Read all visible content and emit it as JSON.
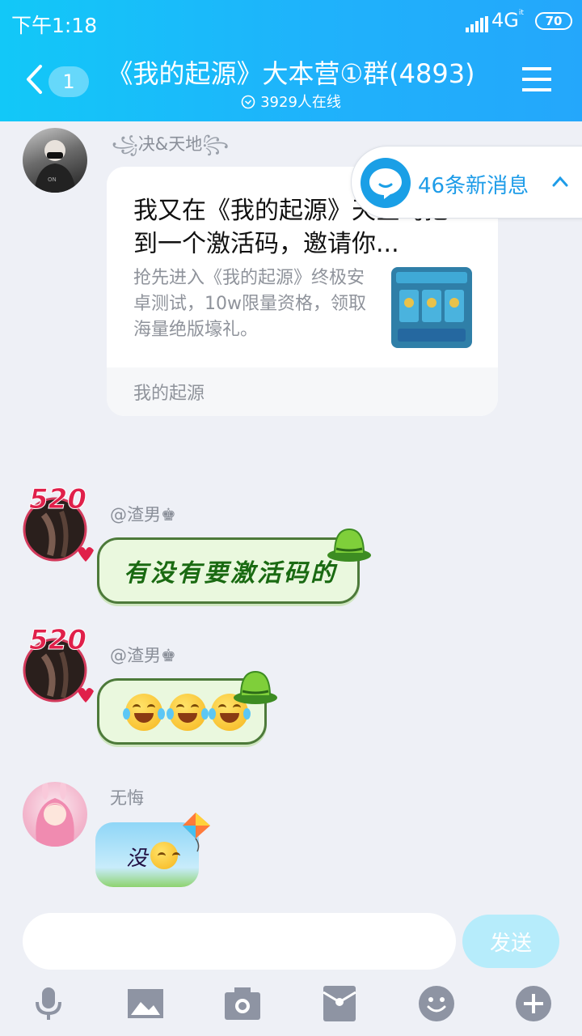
{
  "status_bar": {
    "time": "下午1:18",
    "network": "4G",
    "network_sub": "it",
    "battery": "70"
  },
  "header": {
    "back_badge": "1",
    "title": "《我的起源》大本营①群(4893)",
    "online": "3929人在线"
  },
  "new_messages": {
    "label": "46条新消息"
  },
  "messages": [
    {
      "sender": "决&天地",
      "card": {
        "title": "我又在《我的起源》天空岛挖到一个激活码，邀请你...",
        "description": "抢先进入《我的起源》终极安卓测试，10w限量资格，领取海量绝版壕礼。",
        "source": "我的起源"
      }
    },
    {
      "sender": "@渣男♚",
      "text": "有没有要激活码的"
    },
    {
      "sender": "@渣男♚",
      "emoji": "face-with-tears-of-joy x3"
    },
    {
      "sender": "无悔",
      "text": "没"
    }
  ],
  "composer": {
    "placeholder": "",
    "send_label": "发送"
  },
  "toolbar_icons": [
    "microphone-icon",
    "image-icon",
    "camera-icon",
    "red-packet-icon",
    "emoji-icon",
    "plus-icon"
  ],
  "colors": {
    "header_start": "#12c8f8",
    "header_end": "#24a7fb",
    "accent": "#1e9ce8",
    "background": "#eef0f6"
  }
}
